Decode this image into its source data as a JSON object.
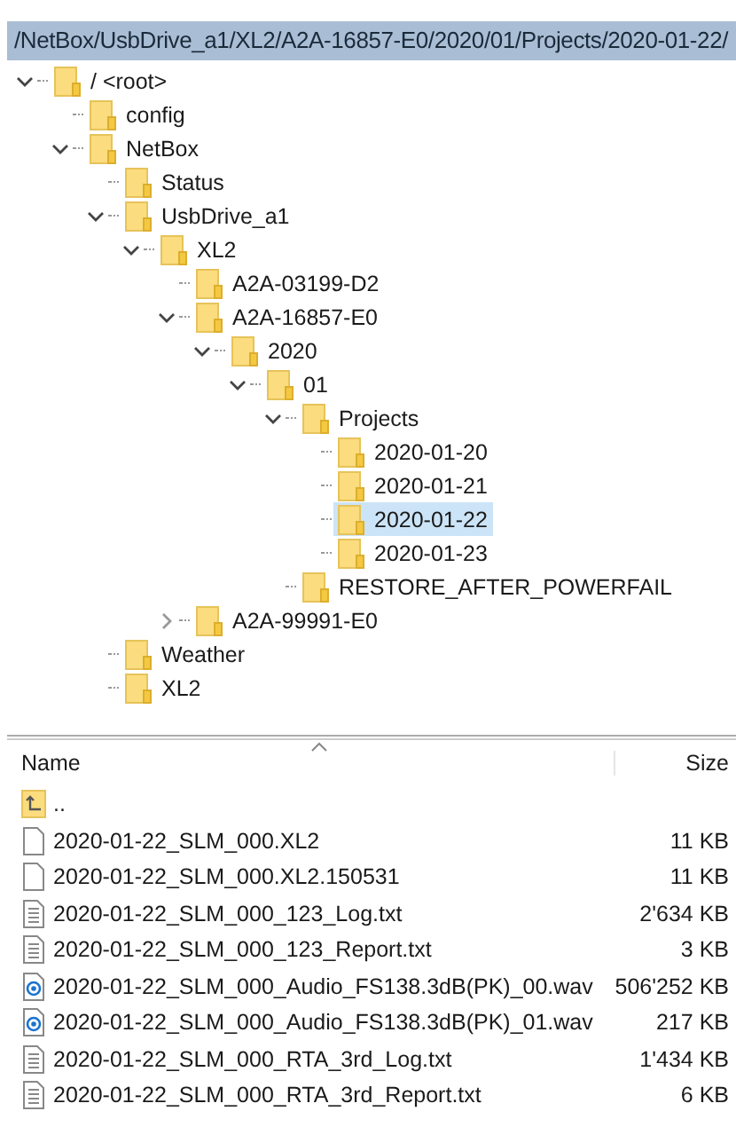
{
  "path_bar": {
    "text": "/NetBox/UsbDrive_a1/XL2/A2A-16857-E0/2020/01/Projects/2020-01-22/"
  },
  "tree": [
    {
      "label": "/ <root>",
      "expanded": true,
      "selected": false,
      "children": [
        {
          "label": "config",
          "selected": false
        },
        {
          "label": "NetBox",
          "expanded": true,
          "selected": false,
          "children": [
            {
              "label": "Status",
              "selected": false
            },
            {
              "label": "UsbDrive_a1",
              "expanded": true,
              "selected": false,
              "children": [
                {
                  "label": "XL2",
                  "expanded": true,
                  "selected": false,
                  "children": [
                    {
                      "label": "A2A-03199-D2",
                      "selected": false
                    },
                    {
                      "label": "A2A-16857-E0",
                      "expanded": true,
                      "selected": false,
                      "children": [
                        {
                          "label": "2020",
                          "expanded": true,
                          "selected": false,
                          "children": [
                            {
                              "label": "01",
                              "expanded": true,
                              "selected": false,
                              "children": [
                                {
                                  "label": "Projects",
                                  "expanded": true,
                                  "selected": false,
                                  "children": [
                                    {
                                      "label": "2020-01-20",
                                      "selected": false
                                    },
                                    {
                                      "label": "2020-01-21",
                                      "selected": false
                                    },
                                    {
                                      "label": "2020-01-22",
                                      "selected": true
                                    },
                                    {
                                      "label": "2020-01-23",
                                      "selected": false
                                    }
                                  ]
                                },
                                {
                                  "label": "RESTORE_AFTER_POWERFAIL",
                                  "selected": false
                                }
                              ]
                            }
                          ]
                        }
                      ]
                    },
                    {
                      "label": "A2A-99991-E0",
                      "expanded": false,
                      "selected": false
                    }
                  ]
                }
              ]
            },
            {
              "label": "Weather",
              "selected": false
            },
            {
              "label": "XL2",
              "selected": false
            }
          ]
        }
      ]
    }
  ],
  "file_list": {
    "columns": [
      "Name",
      "Size"
    ],
    "rows": [
      {
        "kind": "parent",
        "name": "..",
        "size": ""
      },
      {
        "kind": "file",
        "name": "2020-01-22_SLM_000.XL2",
        "size": "11 KB"
      },
      {
        "kind": "file",
        "name": "2020-01-22_SLM_000.XL2.150531",
        "size": "11 KB"
      },
      {
        "kind": "text",
        "name": "2020-01-22_SLM_000_123_Log.txt",
        "size": "2'634 KB"
      },
      {
        "kind": "text",
        "name": "2020-01-22_SLM_000_123_Report.txt",
        "size": "3 KB"
      },
      {
        "kind": "audio",
        "name": "2020-01-22_SLM_000_Audio_FS138.3dB(PK)_00.wav",
        "size": "506'252 KB"
      },
      {
        "kind": "audio",
        "name": "2020-01-22_SLM_000_Audio_FS138.3dB(PK)_01.wav",
        "size": "217 KB"
      },
      {
        "kind": "text",
        "name": "2020-01-22_SLM_000_RTA_3rd_Log.txt",
        "size": "1'434 KB"
      },
      {
        "kind": "text",
        "name": "2020-01-22_SLM_000_RTA_3rd_Report.txt",
        "size": "6 KB"
      }
    ]
  }
}
